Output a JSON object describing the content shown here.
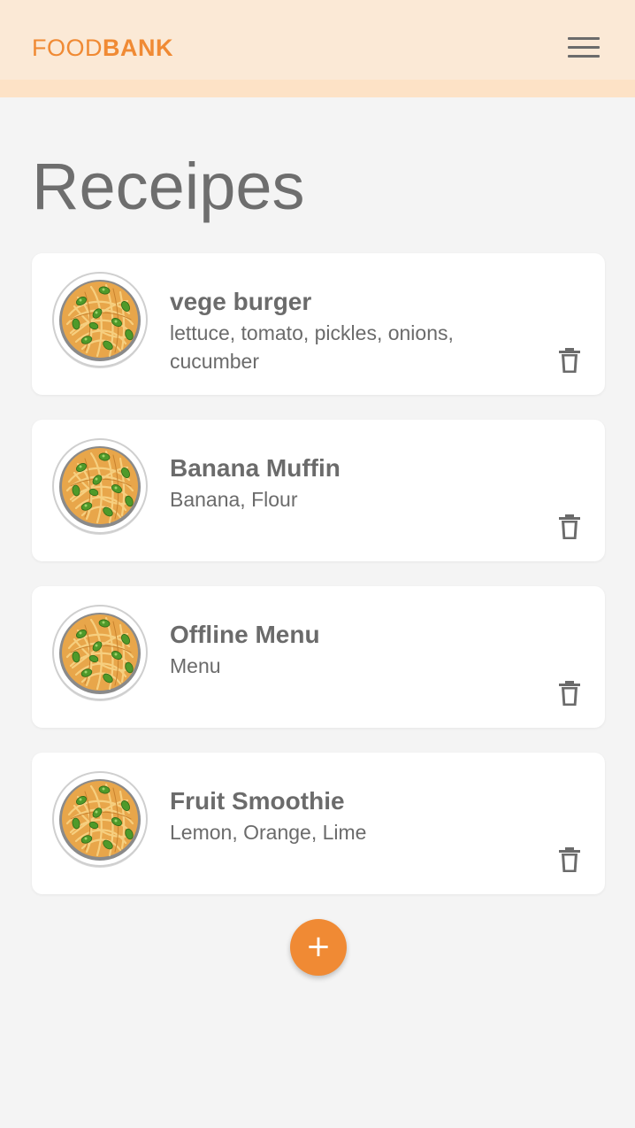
{
  "header": {
    "brand_light": "FOOD",
    "brand_bold": "BANK",
    "menu_icon": "hamburger-menu-icon",
    "brand_color": "#f08a34",
    "bar_color": "#fbe9d6"
  },
  "page": {
    "title": "Receipes"
  },
  "recipes": [
    {
      "title": "vege burger",
      "ingredients": "lettuce, tomato, pickles, onions, cucumber",
      "image_icon": "noodle-bowl-icon",
      "delete_icon": "trash-icon"
    },
    {
      "title": "Banana Muffin",
      "ingredients": "Banana, Flour",
      "image_icon": "noodle-bowl-icon",
      "delete_icon": "trash-icon"
    },
    {
      "title": "Offline Menu",
      "ingredients": "Menu",
      "image_icon": "noodle-bowl-icon",
      "delete_icon": "trash-icon"
    },
    {
      "title": "Fruit Smoothie",
      "ingredients": "Lemon, Orange, Lime",
      "image_icon": "noodle-bowl-icon",
      "delete_icon": "trash-icon"
    }
  ],
  "fab": {
    "label": "+",
    "icon": "plus-icon",
    "color": "#f08a34"
  }
}
